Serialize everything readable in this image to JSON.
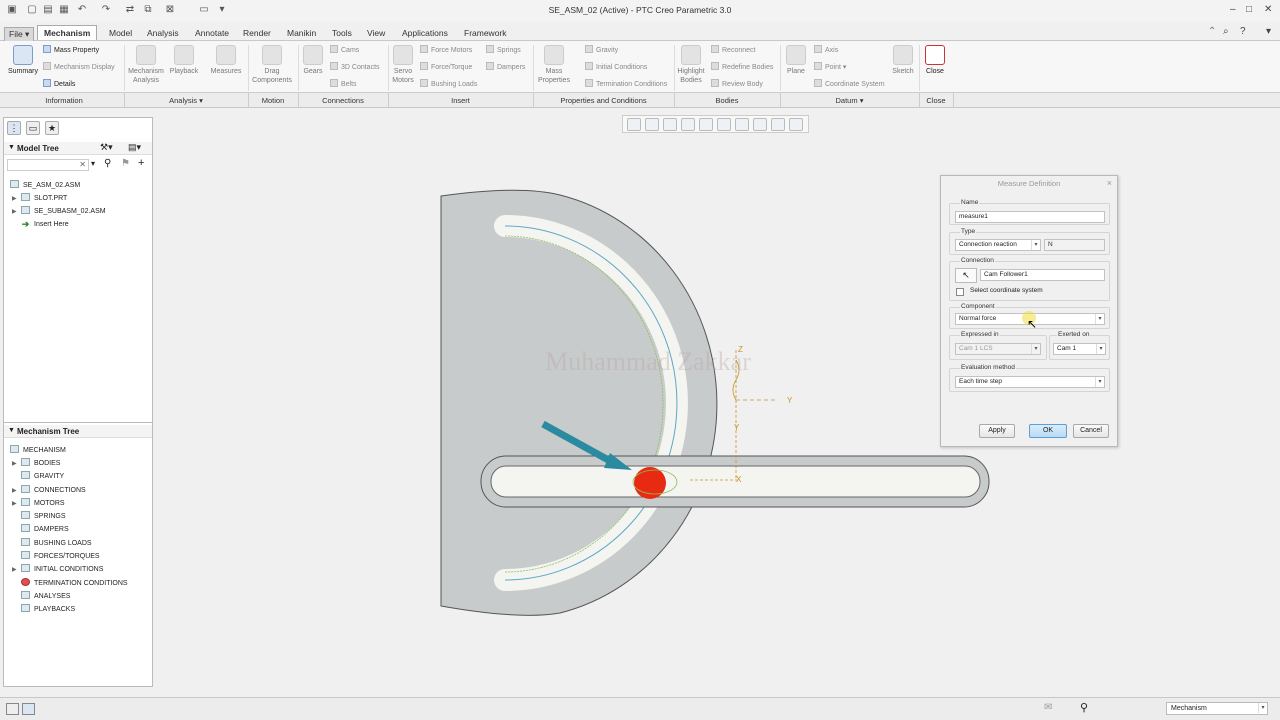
{
  "window": {
    "title": "SE_ASM_02 (Active) - PTC Creo Parametric 3.0",
    "controls": [
      "–",
      "□",
      "✕"
    ]
  },
  "tabs": [
    {
      "label": "File ▾"
    },
    {
      "label": "Mechanism"
    },
    {
      "label": "Model"
    },
    {
      "label": "Analysis"
    },
    {
      "label": "Annotate"
    },
    {
      "label": "Render"
    },
    {
      "label": "Manikin"
    },
    {
      "label": "Tools"
    },
    {
      "label": "View"
    },
    {
      "label": "Applications"
    },
    {
      "label": "Framework"
    }
  ],
  "ribbon": {
    "summary": "Summary",
    "mass_property": "Mass Property",
    "mechanism_display": "Mechanism Display",
    "details": "Details",
    "mechanism_analysis": [
      "Mechanism",
      "Analysis"
    ],
    "playback": "Playback",
    "measures": "Measures",
    "drag_components": [
      "Drag",
      "Components"
    ],
    "gears": "Gears",
    "cams": "Cams",
    "contacts_3d": "3D Contacts",
    "belts": "Belts",
    "servo_motors": [
      "Servo",
      "Motors"
    ],
    "force_motors": "Force Motors",
    "force_torque": "Force/Torque",
    "bushing_loads": "Bushing Loads",
    "springs": "Springs",
    "dampers": "Dampers",
    "mass_properties": [
      "Mass",
      "Properties"
    ],
    "gravity": "Gravity",
    "initial_conditions": "Initial Conditions",
    "termination_conditions": "Termination Conditions",
    "highlight_bodies": [
      "Highlight",
      "Bodies"
    ],
    "reconnect": "Reconnect",
    "redefine_bodies": "Redefine Bodies",
    "review_body": "Review Body",
    "plane": "Plane",
    "axis": "Axis",
    "point": "Point ▾",
    "coordinate_system": "Coordinate System",
    "sketch": "Sketch",
    "close": "Close"
  },
  "groups": {
    "information": "Information",
    "analysis": "Analysis ▾",
    "motion": "Motion",
    "connections": "Connections",
    "insert": "Insert",
    "properties": "Properties and Conditions",
    "bodies": "Bodies",
    "datum": "Datum ▾",
    "close": "Close"
  },
  "model_tree": {
    "header": "Model Tree",
    "search_clear": "✕",
    "items": [
      {
        "label": "SE_ASM_02.ASM"
      },
      {
        "label": "SLOT.PRT"
      },
      {
        "label": "SE_SUBASM_02.ASM"
      },
      {
        "label": "Insert Here"
      }
    ]
  },
  "mechanism_tree": {
    "header": "Mechanism Tree",
    "items": [
      {
        "label": "MECHANISM"
      },
      {
        "label": "BODIES"
      },
      {
        "label": "GRAVITY"
      },
      {
        "label": "CONNECTIONS"
      },
      {
        "label": "MOTORS"
      },
      {
        "label": "SPRINGS"
      },
      {
        "label": "DAMPERS"
      },
      {
        "label": "BUSHING LOADS"
      },
      {
        "label": "FORCES/TORQUES"
      },
      {
        "label": "INITIAL CONDITIONS"
      },
      {
        "label": "TERMINATION CONDITIONS"
      },
      {
        "label": "ANALYSES"
      },
      {
        "label": "PLAYBACKS"
      }
    ]
  },
  "viewport": {
    "watermark": "Muhammad Zakkar",
    "axis_labels": {
      "z": "Z",
      "y_dash": "Y",
      "y": "Y",
      "x": "X"
    }
  },
  "dialog": {
    "title": "Measure Definition",
    "close": "×",
    "name_label": "Name",
    "name_value": "measure1",
    "type_label": "Type",
    "type_value": "Connection reaction",
    "unit_value": "N",
    "connection_label": "Connection",
    "connection_value": "Cam Follower1",
    "select_cs_label": "Select coordinate system",
    "select_cs_checked": false,
    "component_label": "Component",
    "component_value": "Normal force",
    "expressed_label": "Expressed in",
    "expressed_value": "Cam 1 LCS",
    "exerted_label": "Exerted on",
    "exerted_value": "Cam 1",
    "eval_label": "Evaluation method",
    "eval_value": "Each time step",
    "apply": "Apply",
    "ok": "OK",
    "cancel": "Cancel"
  },
  "statusbar": {
    "mode_value": "Mechanism"
  },
  "colors": {
    "part_gray": "#c8cbcc",
    "slot_highlight": "#f4f4f1",
    "follower_red": "#e82a12",
    "force_arrow": "#2a8aa0",
    "datum_orange": "#c89422",
    "accent_blue": "#5c9ed6"
  }
}
